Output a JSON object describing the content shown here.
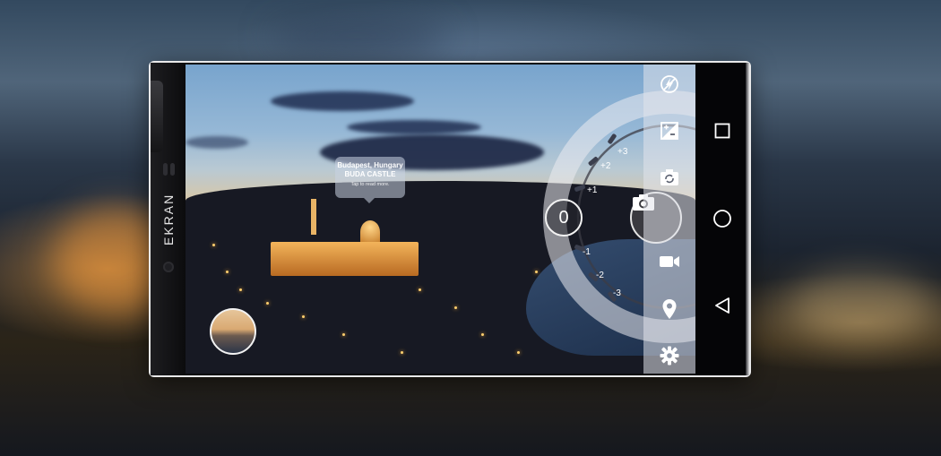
{
  "app": {
    "brand": "EKRAN"
  },
  "location_bubble": {
    "city": "Budapest, Hungary",
    "place": "BUDA CASTLE",
    "hint": "Tap to read more."
  },
  "exposure_dial": {
    "current_value": "0",
    "ticks": [
      "+3",
      "+2",
      "+1",
      "-1",
      "-2",
      "-3"
    ]
  },
  "tools": [
    {
      "icon": "flash-off-icon"
    },
    {
      "icon": "exposure-icon"
    },
    {
      "icon": "switch-camera-icon"
    },
    {
      "icon": "video-icon"
    },
    {
      "icon": "location-pin-icon"
    },
    {
      "icon": "settings-gear-icon"
    }
  ],
  "nav": [
    {
      "icon": "recent-apps-icon"
    },
    {
      "icon": "home-icon"
    },
    {
      "icon": "back-icon"
    }
  ],
  "colors": {
    "accent_dial": "#e9e9ee",
    "marker": "#3b3f4e",
    "shutter": "#3a3a40"
  }
}
